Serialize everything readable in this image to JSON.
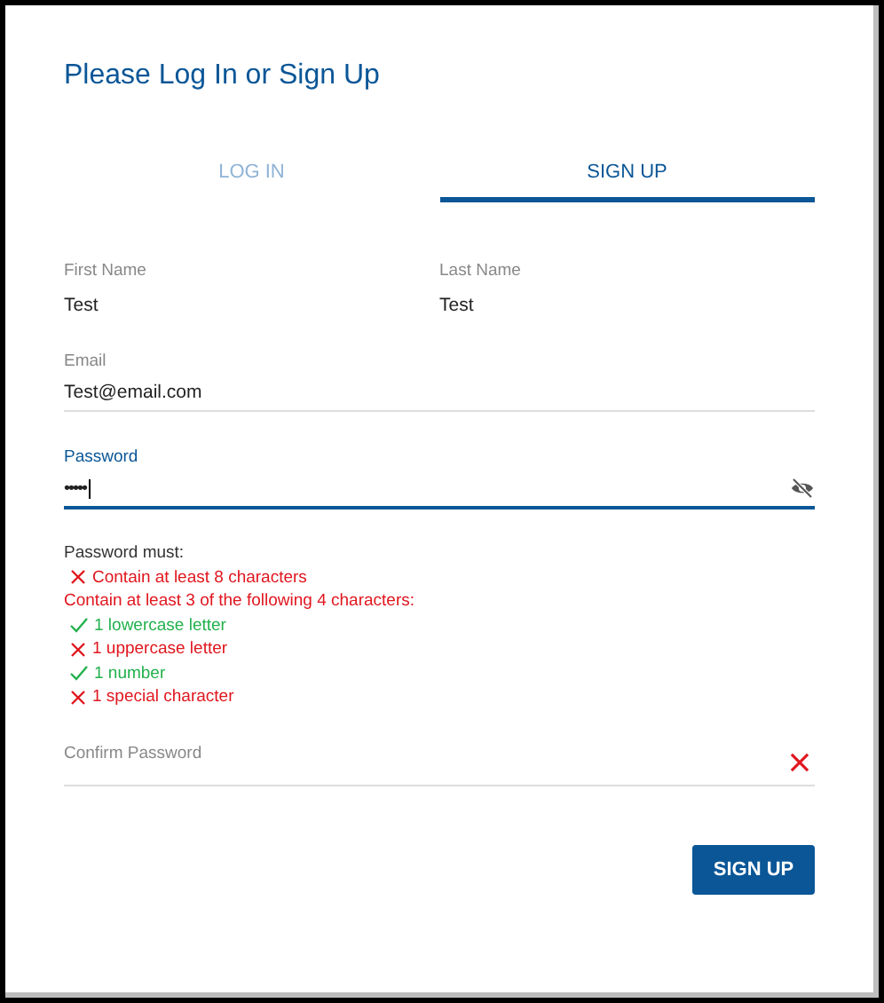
{
  "title": "Please Log In or Sign Up",
  "tabs": [
    {
      "label": "LOG IN",
      "selected": false
    },
    {
      "label": "SIGN UP",
      "selected": true
    }
  ],
  "name_fields": [
    {
      "label": "First Name",
      "value": "Test"
    },
    {
      "label": "Last Name",
      "value": "Test"
    }
  ],
  "email": {
    "label": "Email",
    "value": "Test@email.com",
    "focused": false
  },
  "password": {
    "label": "Password",
    "value": "•••••",
    "focused": true
  },
  "rules": [
    {
      "kind": "intro",
      "text": "Password must:"
    },
    {
      "kind": "rule",
      "text": "Contain at least 8 characters",
      "met": false
    },
    {
      "kind": "heading",
      "text": "Contain at least 3 of the following 4 characters:",
      "met": false
    },
    {
      "kind": "rule",
      "text": "1 lowercase letter",
      "met": true
    },
    {
      "kind": "rule",
      "text": "1 uppercase letter",
      "met": false
    },
    {
      "kind": "rule",
      "text": "1 number",
      "met": true
    },
    {
      "kind": "rule",
      "text": "1 special character",
      "met": false
    }
  ],
  "confirm_password": {
    "placeholder": "Confirm Password",
    "invalid": true
  },
  "submit": "SIGN UP"
}
